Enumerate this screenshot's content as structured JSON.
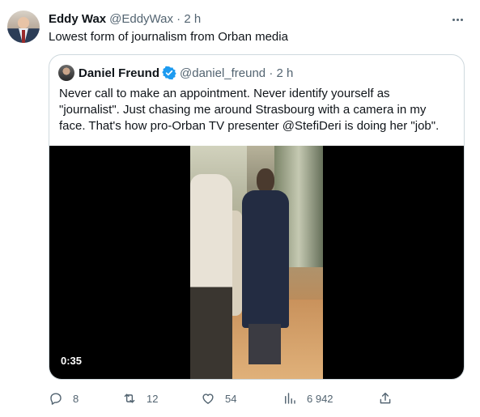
{
  "tweet": {
    "author_name": "Eddy Wax",
    "author_meta": "@EddyWax · 2 h",
    "text": "Lowest form of journalism from Orban media"
  },
  "quoted_tweet": {
    "author_name": "Daniel Freund",
    "author_meta": "@daniel_freund · 2 h",
    "text_lines": [
      "Never call to make an appointment. Never identify yourself as",
      "\"journalist\". Just chasing me around Strasbourg with a camera in my",
      "face. That's how pro-Orban TV presenter @StefiDeri is doing her \"job\"."
    ],
    "video_duration": "0:35"
  },
  "actions": {
    "replies": "8",
    "retweets": "12",
    "likes": "54",
    "views": "6 942"
  },
  "icons": {
    "more": "more-icon",
    "verified": "verified-badge-icon",
    "reply": "reply-icon",
    "retweet": "retweet-icon",
    "like": "like-icon",
    "views": "views-icon",
    "share": "share-icon"
  },
  "colors": {
    "text_primary": "#0f1419",
    "text_secondary": "#536471",
    "verified_blue": "#1d9bf0",
    "border": "#cfd9de"
  }
}
